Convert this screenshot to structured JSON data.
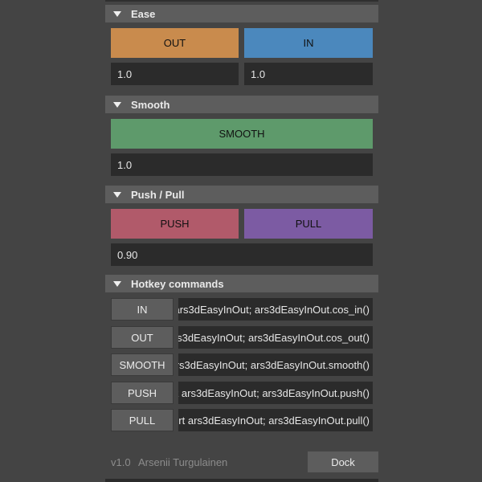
{
  "sections": {
    "ease": {
      "title": "Ease",
      "out_label": "OUT",
      "in_label": "IN",
      "out_value": "1.0",
      "in_value": "1.0",
      "out_color": "#c98b4d",
      "in_color": "#4b88bd"
    },
    "smooth": {
      "title": "Smooth",
      "label": "SMOOTH",
      "value": "1.0",
      "color": "#5e9a6b"
    },
    "pushpull": {
      "title": "Push / Pull",
      "push_label": "PUSH",
      "pull_label": "PULL",
      "value": "0.90",
      "push_color": "#b15a6a",
      "pull_color": "#7c5ba3"
    },
    "hotkeys": {
      "title": "Hotkey commands",
      "rows": [
        {
          "label": "IN",
          "command": "ars3dEasyInOut; ars3dEasyInOut.cos_in()"
        },
        {
          "label": "OUT",
          "command": "rs3dEasyInOut; ars3dEasyInOut.cos_out()"
        },
        {
          "label": "SMOOTH",
          "command": "rs3dEasyInOut; ars3dEasyInOut.smooth()"
        },
        {
          "label": "PUSH",
          "command": "t ars3dEasyInOut; ars3dEasyInOut.push()"
        },
        {
          "label": "PULL",
          "command": "rt ars3dEasyInOut; ars3dEasyInOut.pull()"
        }
      ]
    }
  },
  "footer": {
    "version": "v1.0",
    "author": "Arsenii Turgulainen",
    "dock_label": "Dock"
  },
  "icons": {
    "collapse": "triangle-down-icon"
  }
}
